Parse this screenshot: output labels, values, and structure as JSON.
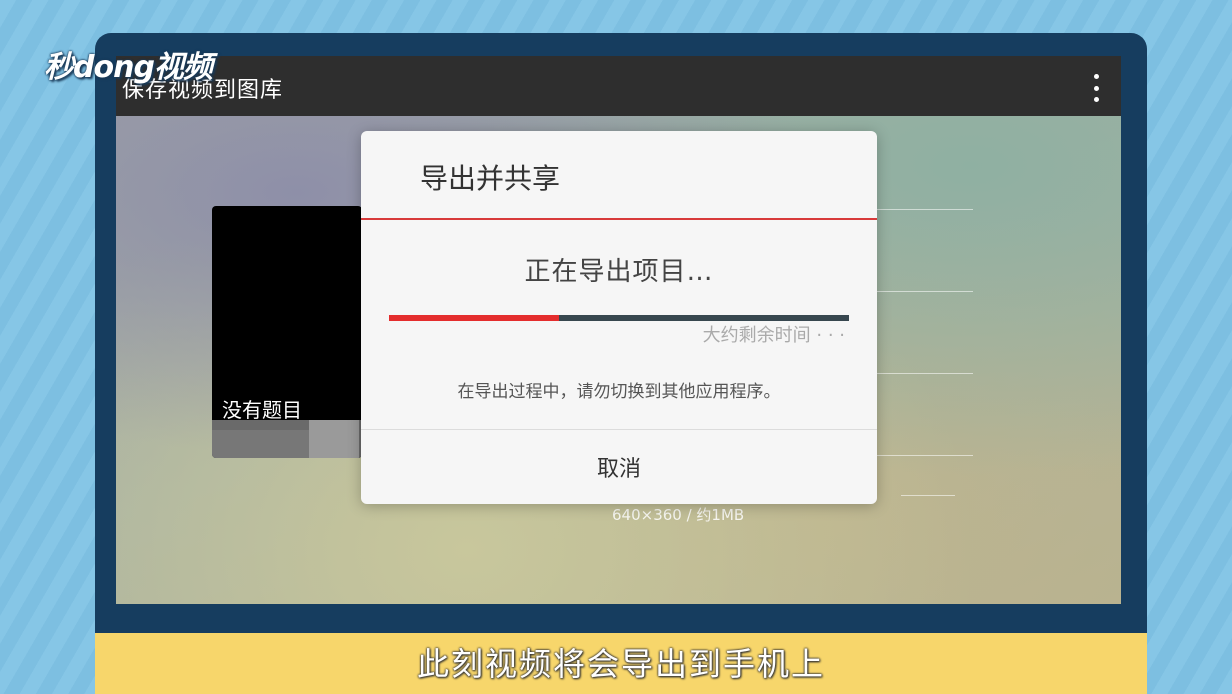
{
  "logo": {
    "text": "秒dong视频"
  },
  "appbar": {
    "title": "保存视频到图库",
    "menu_icon": "more-vert-icon"
  },
  "video": {
    "title": "没有题目"
  },
  "background": {
    "size_info": "640×360 / 约1MB"
  },
  "dialog": {
    "title": "导出并共享",
    "status": "正在导出项目…",
    "progress_percent": 37,
    "eta": "大约剩余时间 · · ·",
    "note": "在导出过程中，请勿切换到其他应用程序。",
    "cancel_label": "取消"
  },
  "caption": {
    "text": "此刻视频将会导出到手机上"
  },
  "colors": {
    "accent": "#e42d2d",
    "frame": "#163d5f",
    "caption_bar": "#f7d66b"
  }
}
